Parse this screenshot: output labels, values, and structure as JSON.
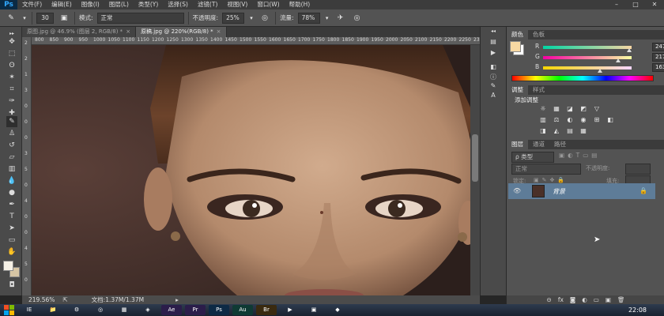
{
  "app": {
    "logo": "Ps"
  },
  "menubar": {
    "items": [
      "文件(F)",
      "编辑(E)",
      "图像(I)",
      "图层(L)",
      "类型(Y)",
      "选择(S)",
      "滤镜(T)",
      "视图(V)",
      "窗口(W)",
      "帮助(H)"
    ],
    "window_controls": [
      "–",
      "□",
      "✕"
    ]
  },
  "optionsbar": {
    "brush_size": "30",
    "mode_label": "模式:",
    "mode_value": "正常",
    "opacity_label": "不透明度:",
    "opacity_value": "25%",
    "flow_label": "流量:",
    "flow_value": "78%"
  },
  "tabs": [
    {
      "title": "原图.jpg @ 46.9% (图层 2, RGB/8) *",
      "close": "×",
      "active": false
    },
    {
      "title": "原稿.jpg @ 220%(RGB/8) *",
      "close": "×",
      "active": true
    }
  ],
  "rulers": {
    "top": [
      "800",
      "850",
      "900",
      "950",
      "1000",
      "1050",
      "1100",
      "1150",
      "1200",
      "1250",
      "1300",
      "1350",
      "1400",
      "1450",
      "1500",
      "1550",
      "1600",
      "1650",
      "1700",
      "1750",
      "1800",
      "1850",
      "1900",
      "1950",
      "2000",
      "2050",
      "2100",
      "2150",
      "2200",
      "2250",
      "2300"
    ],
    "left": [
      "2",
      "2",
      "1",
      "3",
      "0",
      "0",
      "0",
      "3",
      "5",
      "0",
      "4",
      "0",
      "0",
      "4",
      "5",
      "0"
    ]
  },
  "statusbar": {
    "zoom": "219.56%",
    "doc_info": "文档:1.37M/1.37M"
  },
  "color_panel": {
    "tabs": [
      "颜色",
      "色板"
    ],
    "channels": [
      {
        "label": "R",
        "value": "247",
        "level": 0.97,
        "gradient": "linear-gradient(to right,#00d6a3,#f7d6a3)"
      },
      {
        "label": "G",
        "value": "217",
        "level": 0.85,
        "gradient": "linear-gradient(to right,#f700a3,#f7ffa3)"
      },
      {
        "label": "B",
        "value": "163",
        "level": 0.64,
        "gradient": "linear-gradient(to right,#f7d600,#f7d6ff)"
      }
    ],
    "foreground_color": "#f7d9a3",
    "background_color": "#ffffff"
  },
  "adjust_panel": {
    "tabs": [
      "调整",
      "样式"
    ],
    "title": "添加调整",
    "icons": [
      "☼",
      "▦",
      "◪",
      "◩",
      "▽",
      "▥",
      "⚖",
      "◐",
      "◉",
      "⊞",
      "◧",
      "◨",
      "◭",
      "▤",
      "▦"
    ]
  },
  "layers_panel": {
    "tabs": [
      "图层",
      "通道",
      "路径"
    ],
    "filter_label": "ρ 类型",
    "blend_mode": "正常",
    "opacity_label": "不透明度:",
    "lock_label": "锁定:",
    "fill_label": "填充:",
    "layers": [
      {
        "name": "背景",
        "locked": true,
        "visible": true
      }
    ],
    "footer_icons": [
      "⊝",
      "fx",
      "◙",
      "◐",
      "▭",
      "▣",
      "🗑"
    ]
  },
  "taskbar": {
    "apps": [
      "IE",
      "📁",
      "⚙",
      "◎",
      "▦",
      "◈",
      "Ae",
      "Pr",
      "Ps",
      "Au",
      "Br",
      "▶",
      "▣",
      "◆"
    ],
    "active_app": "Ps",
    "clock": "22:08"
  }
}
